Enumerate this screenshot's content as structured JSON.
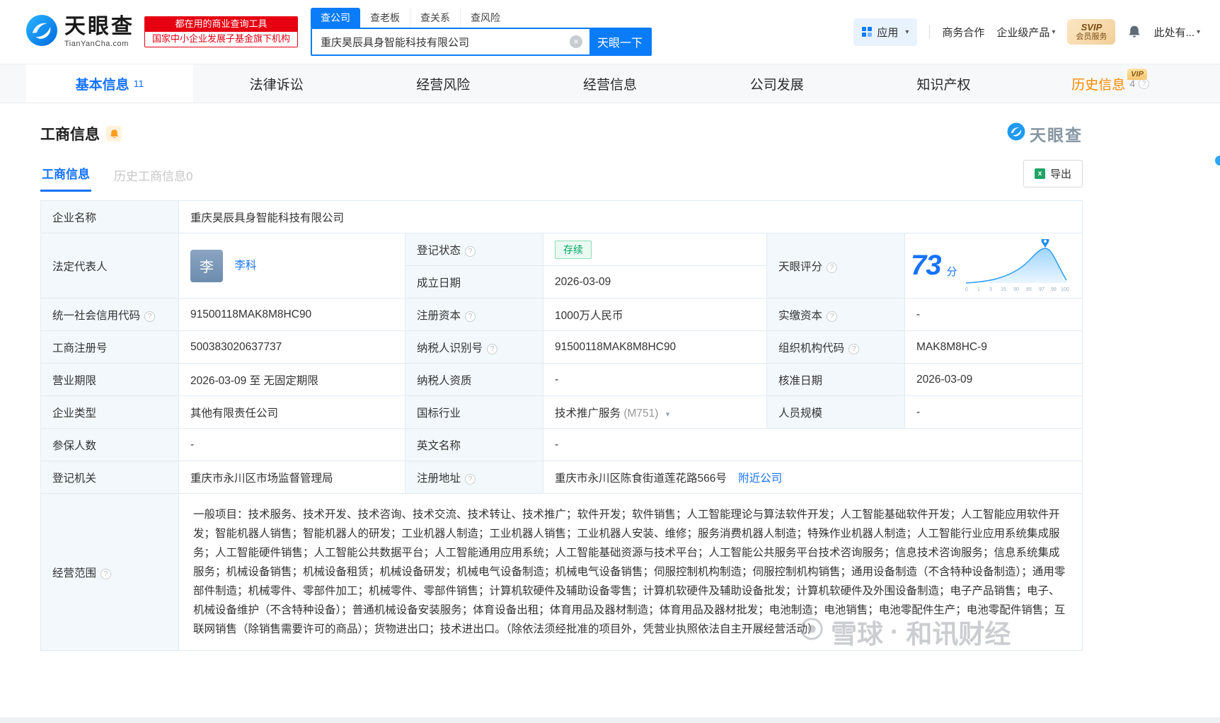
{
  "colors": {
    "accent": "#0b7cf8",
    "status_green": "#00a661",
    "history_orange": "#ff8a00",
    "brand_red": "#e60012"
  },
  "brand": {
    "name": "天眼查",
    "domain": "TianYanCha.com",
    "slogan1": "都在用的商业查询工具",
    "slogan2": "国家中小企业发展子基金旗下机构"
  },
  "search": {
    "tabs": [
      {
        "label": "查公司"
      },
      {
        "label": "查老板"
      },
      {
        "label": "查关系"
      },
      {
        "label": "查风险"
      }
    ],
    "value": "重庆昊辰具身智能科技有限公司",
    "button": "天眼一下"
  },
  "header_right": {
    "apps": "应用",
    "cooperation": "商务合作",
    "enterprise": "企业级产品",
    "svip_top": "SVIP",
    "svip_bottom": "会员服务",
    "user": "此处有..."
  },
  "nav": {
    "tabs": [
      {
        "label": "基本信息",
        "count": "11"
      },
      {
        "label": "法律诉讼"
      },
      {
        "label": "经营风险"
      },
      {
        "label": "经营信息"
      },
      {
        "label": "公司发展"
      },
      {
        "label": "知识产权"
      },
      {
        "label": "历史信息",
        "count": "4",
        "vip": "VIP"
      }
    ]
  },
  "section": {
    "title": "工商信息",
    "logo": "天眼查",
    "subtabs": [
      {
        "label": "工商信息"
      },
      {
        "label": "历史工商信息",
        "count": "0"
      }
    ],
    "export": "导出"
  },
  "fields": {
    "company_name": {
      "label": "企业名称",
      "value": "重庆昊辰具身智能科技有限公司"
    },
    "legal_rep": {
      "label": "法定代表人",
      "avatar": "李",
      "name": "李科"
    },
    "reg_status": {
      "label": "登记状态",
      "value": "存续"
    },
    "establish_date": {
      "label": "成立日期",
      "value": "2026-03-09"
    },
    "score": {
      "label": "天眼评分",
      "value": "73",
      "unit": "分",
      "ticks": [
        "0",
        "1",
        "3",
        "15",
        "50",
        "85",
        "97",
        "99",
        "100"
      ]
    },
    "credit_code": {
      "label": "统一社会信用代码",
      "value": "91500118MAK8M8HC90"
    },
    "reg_capital": {
      "label": "注册资本",
      "value": "1000万人民币"
    },
    "paid_capital": {
      "label": "实缴资本",
      "value": "-"
    },
    "reg_number": {
      "label": "工商注册号",
      "value": "500383020637737"
    },
    "taxpayer_id": {
      "label": "纳税人识别号",
      "value": "91500118MAK8M8HC90"
    },
    "org_code": {
      "label": "组织机构代码",
      "value": "MAK8M8HC-9"
    },
    "business_term": {
      "label": "营业期限",
      "value": "2026-03-09 至 无固定期限"
    },
    "taxpayer_quality": {
      "label": "纳税人资质",
      "value": "-"
    },
    "approval_date": {
      "label": "核准日期",
      "value": "2026-03-09"
    },
    "company_type": {
      "label": "企业类型",
      "value": "其他有限责任公司"
    },
    "industry": {
      "label": "国标行业",
      "value": "技术推广服务",
      "code": "(M751)"
    },
    "staff_size": {
      "label": "人员规模",
      "value": "-"
    },
    "insured_count": {
      "label": "参保人数",
      "value": "-"
    },
    "english_name": {
      "label": "英文名称",
      "value": "-"
    },
    "reg_authority": {
      "label": "登记机关",
      "value": "重庆市永川区市场监督管理局"
    },
    "reg_address": {
      "label": "注册地址",
      "value": "重庆市永川区陈食街道莲花路566号",
      "nearby": "附近公司"
    },
    "business_scope": {
      "label": "经营范围",
      "value": "一般项目：技术服务、技术开发、技术咨询、技术交流、技术转让、技术推广；软件开发；软件销售；人工智能理论与算法软件开发；人工智能基础软件开发；人工智能应用软件开发；智能机器人销售；智能机器人的研发；工业机器人制造；工业机器人销售；工业机器人安装、维修；服务消费机器人制造；特殊作业机器人制造；人工智能行业应用系统集成服务；人工智能硬件销售；人工智能公共数据平台；人工智能通用应用系统；人工智能基础资源与技术平台；人工智能公共服务平台技术咨询服务；信息技术咨询服务；信息系统集成服务；机械设备销售；机械设备租赁；机械设备研发；机械电气设备制造；机械电气设备销售；伺服控制机构制造；伺服控制机构销售；通用设备制造（不含特种设备制造）；通用零部件制造；机械零件、零部件加工；机械零件、零部件销售；计算机软硬件及辅助设备零售；计算机软硬件及辅助设备批发；计算机软硬件及外围设备制造；电子产品销售；电子、机械设备维护（不含特种设备）；普通机械设备安装服务；体育设备出租；体育用品及器材制造；体育用品及器材批发；电池制造；电池销售；电池零配件生产；电池零配件销售；互联网销售（除销售需要许可的商品）；货物进出口；技术进出口。（除依法须经批准的项目外，凭营业执照依法自主开展经营活动）"
    }
  },
  "watermark": {
    "part1": "雪球",
    "sep": "·",
    "part2": "和讯财经"
  }
}
